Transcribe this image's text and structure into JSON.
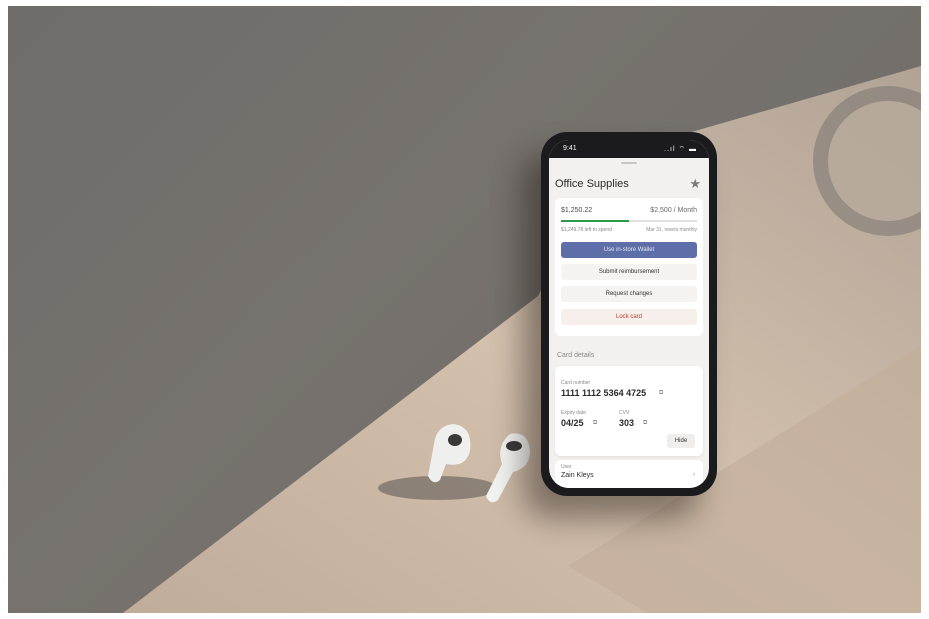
{
  "status": {
    "time": "9:41",
    "icons": "..ıl ⌔ ▬"
  },
  "header": {
    "title": "Office Supplies"
  },
  "budget": {
    "spent": "$1,250.22",
    "limit": "$2,500 / Month",
    "progress": 0.5,
    "left_note": "$1,249.78 left to spend",
    "right_note": "Mar 31, resets monthly",
    "colors": {
      "progress": "#2c9a4a",
      "primary": "#5d6ea8",
      "danger": "#c0392b"
    }
  },
  "actions": {
    "primary": "Use in-store Wallet",
    "reimburse": "Submit reimbursement",
    "request": "Request changes",
    "lock": "Lock card"
  },
  "card_details": {
    "section_label": "Card details",
    "card_number_label": "Card number",
    "card_number": "1111 1112 5364 4725",
    "expiry_label": "Expiry date",
    "expiry": "04/25",
    "cvv_label": "CVV",
    "cvv": "303",
    "hide_label": "Hide"
  },
  "user": {
    "label": "User",
    "name": "Zain Kleys"
  }
}
